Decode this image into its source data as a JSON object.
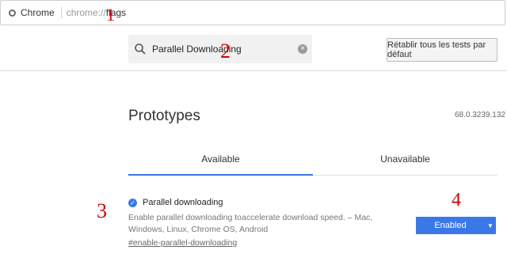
{
  "address_bar": {
    "security_label": "Chrome",
    "url_scheme": "chrome://",
    "url_path": "flags"
  },
  "search": {
    "value": "Parallel Downloading",
    "icon": "search-icon",
    "clear_icon": "clear-icon"
  },
  "reset_button": {
    "label": "Rétablir tous les tests par défaut"
  },
  "main": {
    "title": "Prototypes",
    "version": "68.0.3239.132",
    "tabs": [
      {
        "label": "Available",
        "active": true
      },
      {
        "label": "Unavailable",
        "active": false
      }
    ],
    "experiment": {
      "name": "Parallel downloading",
      "description": "Enable parallel downloading toaccelerate download speed. – Mac, Windows, Linux, Chrome OS, Android",
      "link": "#enable-parallel-downloading",
      "select_value": "Enabled"
    }
  },
  "annotations": [
    "1",
    "2",
    "3",
    "4"
  ],
  "colors": {
    "accent": "#3b78e7",
    "annotation": "#d10000"
  }
}
